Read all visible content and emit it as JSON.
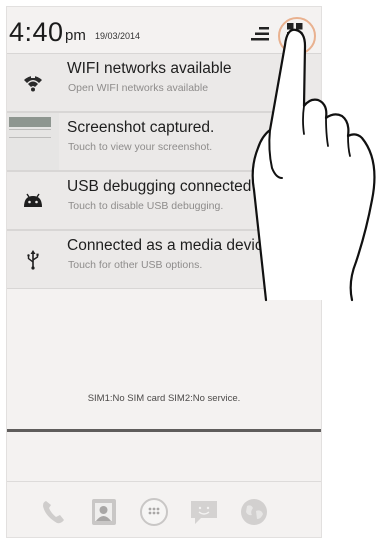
{
  "status_bar": {
    "time": "4:40",
    "ampm": "pm",
    "date": "19/03/2014"
  },
  "notifications": [
    {
      "title": "WIFI networks available",
      "subtitle": "Open WIFI networks available",
      "icon": "wifi-icon"
    },
    {
      "title": "Screenshot captured.",
      "subtitle": "Touch to view your screenshot.",
      "icon": "screenshot-thumbnail"
    },
    {
      "title": "USB debugging connected",
      "subtitle": "Touch to disable USB debugging.",
      "icon": "android-icon"
    },
    {
      "title": "Connected as a media device",
      "subtitle": "Touch for other USB options.",
      "icon": "usb-icon"
    }
  ],
  "sim_status": "SIM1:No SIM card    SIM2:No service.",
  "dock": {
    "items": [
      "phone-icon",
      "contacts-icon",
      "app-drawer-icon",
      "messaging-icon",
      "browser-icon"
    ]
  },
  "colors": {
    "background": "#f4f2f1",
    "notification_bg": "#ebe9e8",
    "highlight": "#e9b18f",
    "text": "#1e1e1e",
    "subtext": "#8e8c8b"
  }
}
